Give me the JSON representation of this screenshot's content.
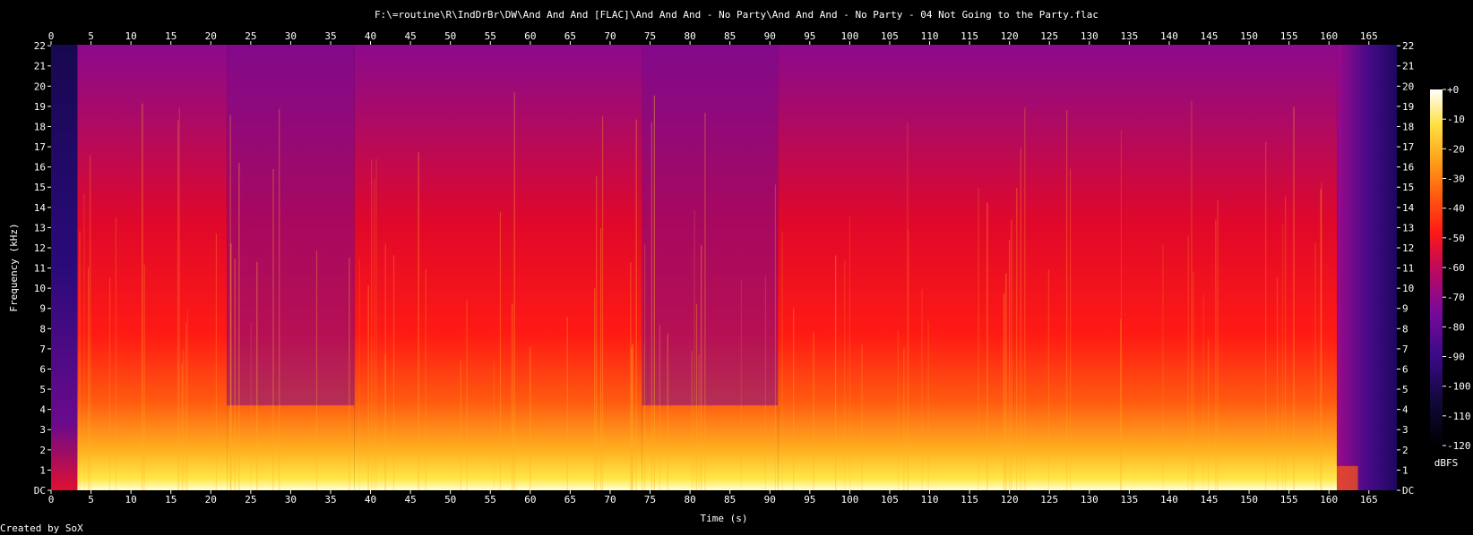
{
  "chart_data": {
    "type": "heatmap",
    "title": "F:\\=routine\\R\\IndDrBr\\DW\\And And And [FLAC]\\And And And - No Party\\And And And - No Party - 04 Not Going to the Party.flac",
    "xlabel": "Time (s)",
    "ylabel": "Frequency (kHz)",
    "xlim": [
      0,
      168.5
    ],
    "ylim": [
      0,
      22.05
    ],
    "x_ticks": [
      0,
      5,
      10,
      15,
      20,
      25,
      30,
      35,
      40,
      45,
      50,
      55,
      60,
      65,
      70,
      75,
      80,
      85,
      90,
      95,
      100,
      105,
      110,
      115,
      120,
      125,
      130,
      135,
      140,
      145,
      150,
      155,
      160,
      165
    ],
    "y_ticks": [
      "DC",
      "1",
      "2",
      "3",
      "4",
      "5",
      "6",
      "7",
      "8",
      "9",
      "10",
      "11",
      "12",
      "13",
      "14",
      "15",
      "16",
      "17",
      "18",
      "19",
      "20",
      "21",
      "22"
    ],
    "colorbar": {
      "label": "dBFS",
      "range": [
        -120,
        0
      ],
      "ticks": [
        "+0",
        "-10",
        "-20",
        "-30",
        "-40",
        "-50",
        "-60",
        "-70",
        "-80",
        "-90",
        "-100",
        "-110",
        "-120"
      ]
    },
    "colors": {
      "background": "#000000",
      "text": "#ffffff",
      "max": "#ffffff",
      "high": "#ffd21e",
      "mid": "#ff1414",
      "low": "#9c0aa0",
      "min": "#000000"
    },
    "segments": [
      {
        "start": 0,
        "end": 3.3,
        "level": "near-silence"
      },
      {
        "start": 3.3,
        "end": 22,
        "level": "loud"
      },
      {
        "start": 22,
        "end": 38,
        "level": "loud-sparse-highs"
      },
      {
        "start": 38,
        "end": 74,
        "level": "loud"
      },
      {
        "start": 74,
        "end": 91,
        "level": "loud-sparse-highs"
      },
      {
        "start": 91,
        "end": 161,
        "level": "loud"
      },
      {
        "start": 161,
        "end": 168.5,
        "level": "fade-out"
      }
    ]
  },
  "footer": {
    "credit": "Created by SoX"
  }
}
